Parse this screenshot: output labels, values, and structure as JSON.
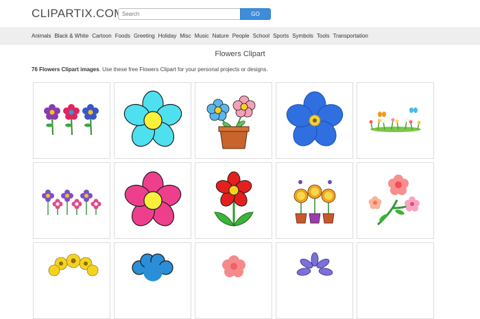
{
  "site": {
    "logo": "CLIPARTIX.COM"
  },
  "search": {
    "placeholder": "Search",
    "button": "GO"
  },
  "nav": [
    "Animals",
    "Black & White",
    "Cartoon",
    "Foods",
    "Greeting",
    "Holiday",
    "Misc",
    "Music",
    "Nature",
    "People",
    "School",
    "Sports",
    "Symbols",
    "Tools",
    "Transportation"
  ],
  "page": {
    "title": "Flowers Clipart",
    "count_label": "76 Flowers Clipart images",
    "intro_rest": ". Use these free Flowers Clipart for your personal projects or designs."
  },
  "colors": {
    "accent": "#3d8ddb",
    "nav_bg": "#eeeeee"
  }
}
